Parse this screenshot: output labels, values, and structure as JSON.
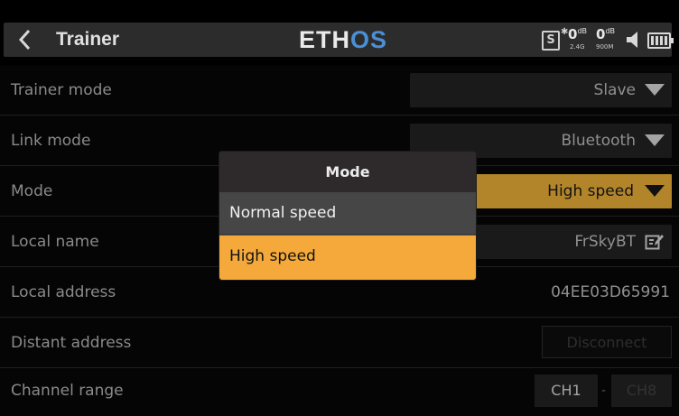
{
  "header": {
    "back_icon": "chevron-left-icon",
    "title": "Trainer",
    "logo_part1": "ETH",
    "logo_part2": "OS",
    "status": {
      "s_badge": "S",
      "rssi_1": "0",
      "rssi_1_unit": "dB",
      "rssi_1_band": "2.4G",
      "rssi_2": "0",
      "rssi_2_unit": "dB",
      "rssi_2_band": "900M"
    }
  },
  "rows": {
    "trainer_mode": {
      "label": "Trainer mode",
      "value": "Slave"
    },
    "link_mode": {
      "label": "Link mode",
      "value": "Bluetooth"
    },
    "mode": {
      "label": "Mode",
      "value": "High speed"
    },
    "local_name": {
      "label": "Local name",
      "value": "FrSkyBT"
    },
    "local_address": {
      "label": "Local address",
      "value": "04EE03D65991"
    },
    "distant_address": {
      "label": "Distant address",
      "button": "Disconnect"
    },
    "channel_range": {
      "label": "Channel range",
      "from": "CH1",
      "separator": "-",
      "to": "CH8"
    }
  },
  "modal": {
    "title": "Mode",
    "options": [
      "Normal speed",
      "High speed"
    ],
    "selected": "High speed"
  },
  "colors": {
    "accent": "#f5a93b",
    "field_highlight": "#b3852b",
    "logo_blue": "#4a8fd6"
  }
}
